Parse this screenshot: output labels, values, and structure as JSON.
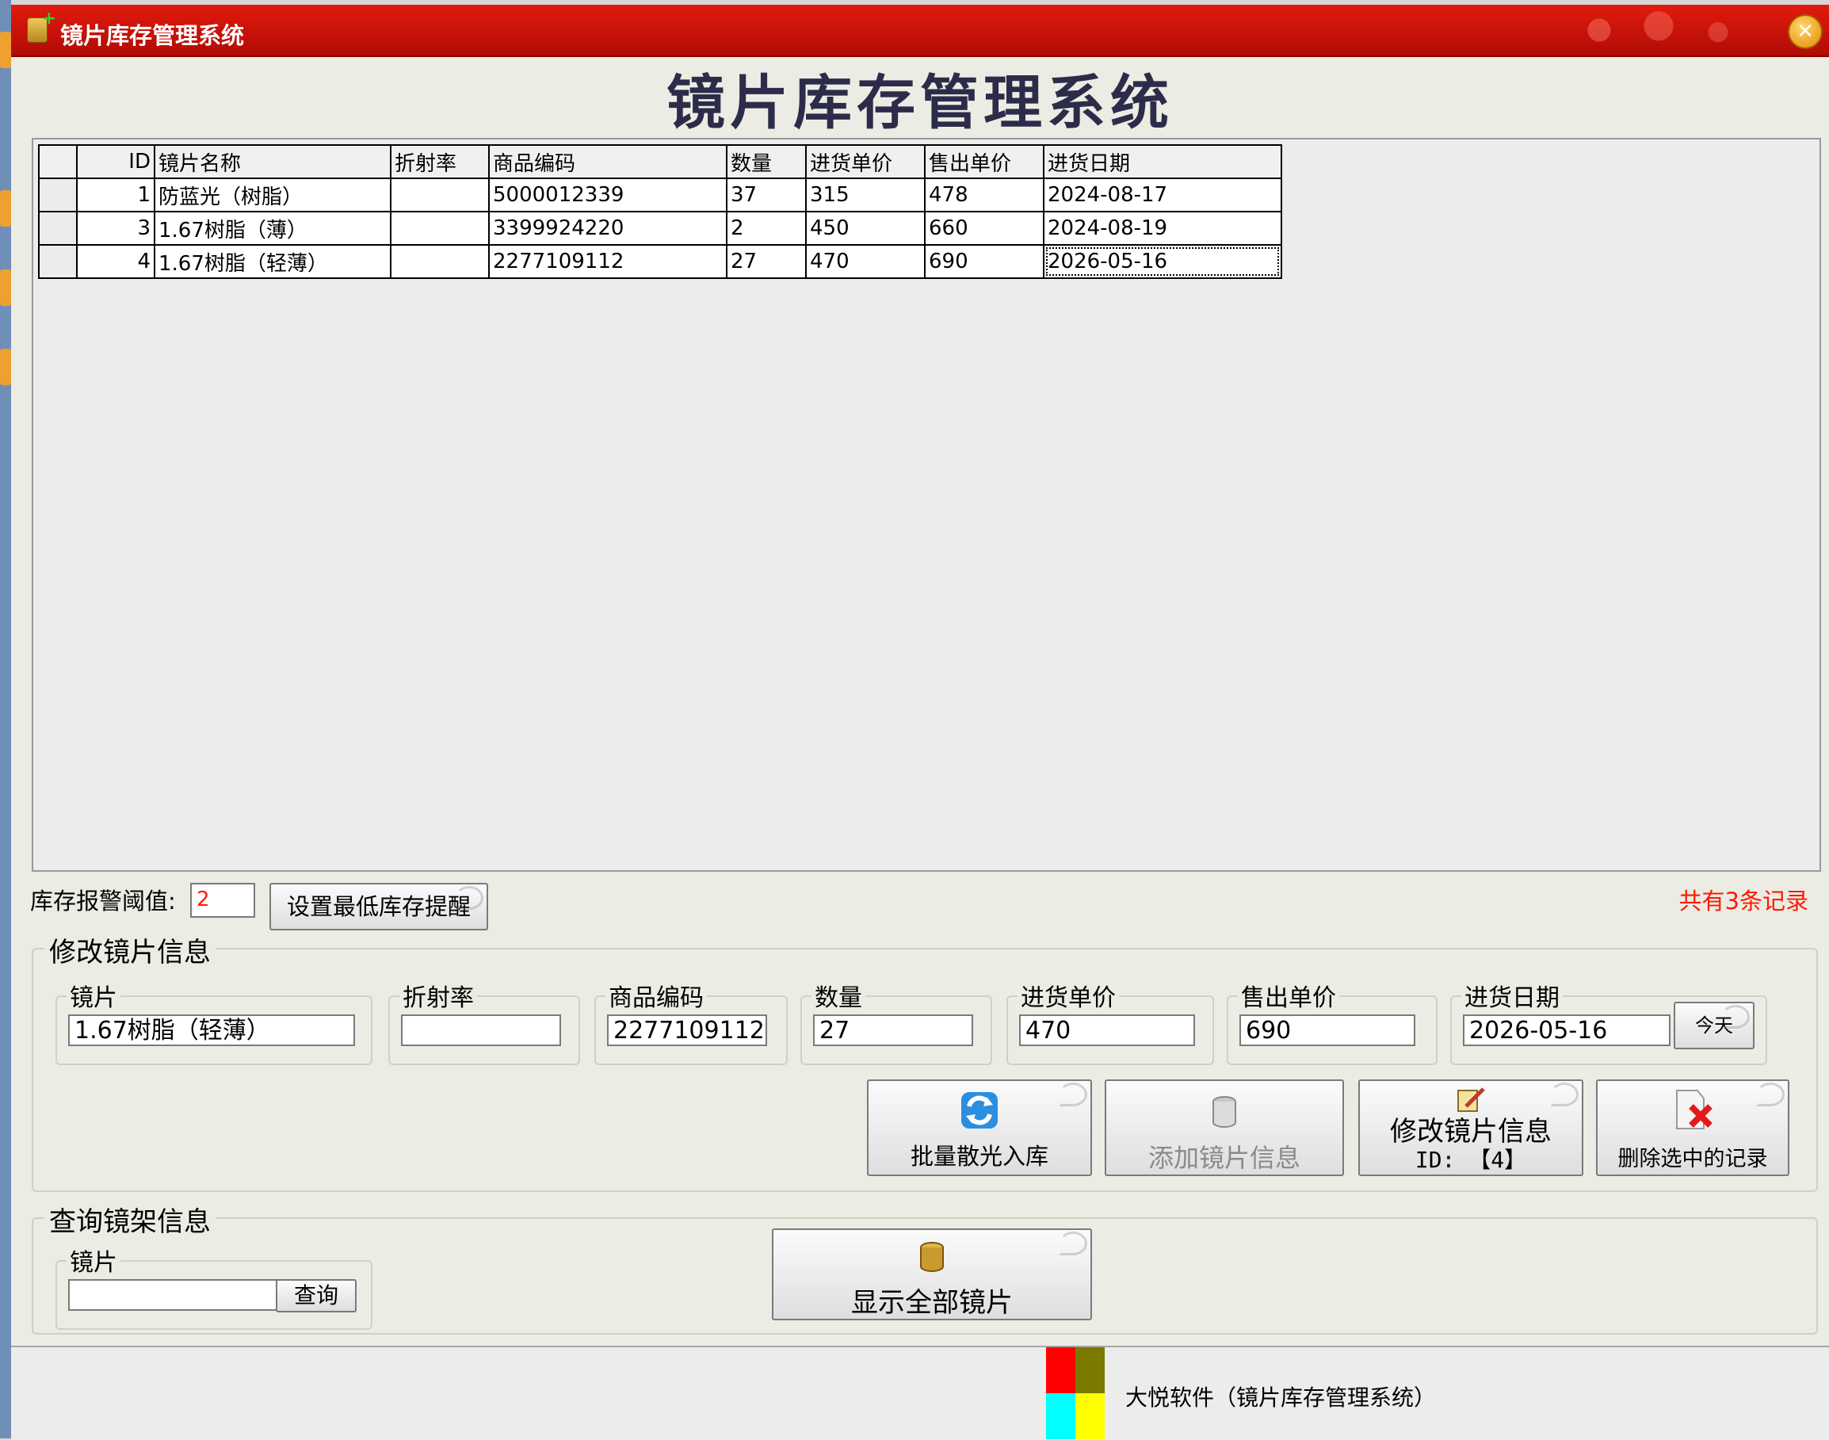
{
  "window": {
    "title": "镜片库存管理系统",
    "close_glyph": "✕"
  },
  "header": {
    "app_title": "镜片库存管理系统"
  },
  "table": {
    "columns": [
      "ID",
      "镜片名称",
      "折射率",
      "商品编码",
      "数量",
      "进货单价",
      "售出单价",
      "进货日期"
    ],
    "rows": [
      {
        "id": "1",
        "name": "防蓝光（树脂）",
        "refraction": "",
        "code": "5000012339",
        "qty": "37",
        "in_price": "315",
        "out_price": "478",
        "date": "2024-08-17"
      },
      {
        "id": "3",
        "name": "1.67树脂（薄）",
        "refraction": "",
        "code": "3399924220",
        "qty": "2",
        "in_price": "450",
        "out_price": "660",
        "date": "2024-08-19"
      },
      {
        "id": "4",
        "name": "1.67树脂（轻薄）",
        "refraction": "",
        "code": "2277109112",
        "qty": "27",
        "in_price": "470",
        "out_price": "690",
        "date": "2026-05-16"
      }
    ]
  },
  "alarm": {
    "label": "库存报警阈值:",
    "value": "2",
    "set_button": "设置最低库存提醒",
    "record_count": "共有3条记录"
  },
  "edit": {
    "group_title": "修改镜片信息",
    "lens_label": "镜片",
    "lens_value": "1.67树脂（轻薄）",
    "refraction_label": "折射率",
    "refraction_value": "",
    "code_label": "商品编码",
    "code_value": "2277109112",
    "qty_label": "数量",
    "qty_value": "27",
    "in_price_label": "进货单价",
    "in_price_value": "470",
    "out_price_label": "售出单价",
    "out_price_value": "690",
    "date_label": "进货日期",
    "date_value": "2026-05-16",
    "today_button": "今天",
    "batch_button": "批量散光入库",
    "add_button": "添加镜片信息",
    "modify_button": "修改镜片信息",
    "modify_id": "ID: 【4】",
    "delete_button": "删除选中的记录"
  },
  "query": {
    "group_title": "查询镜架信息",
    "lens_label": "镜片",
    "lens_value": "",
    "query_button": "查询",
    "show_all_button": "显示全部镜片"
  },
  "status": {
    "company": "大悦软件（镜片库存管理系统）"
  },
  "colors": {
    "titlebar": "#d0150b",
    "alert_text": "#ff1a00",
    "logo": [
      "#ff0000",
      "#7a7a00",
      "#00ffff",
      "#ffff00"
    ]
  },
  "icons": [
    "database-add-icon",
    "close-icon",
    "refresh-icon",
    "database-icon",
    "edit-icon",
    "delete-icon"
  ]
}
